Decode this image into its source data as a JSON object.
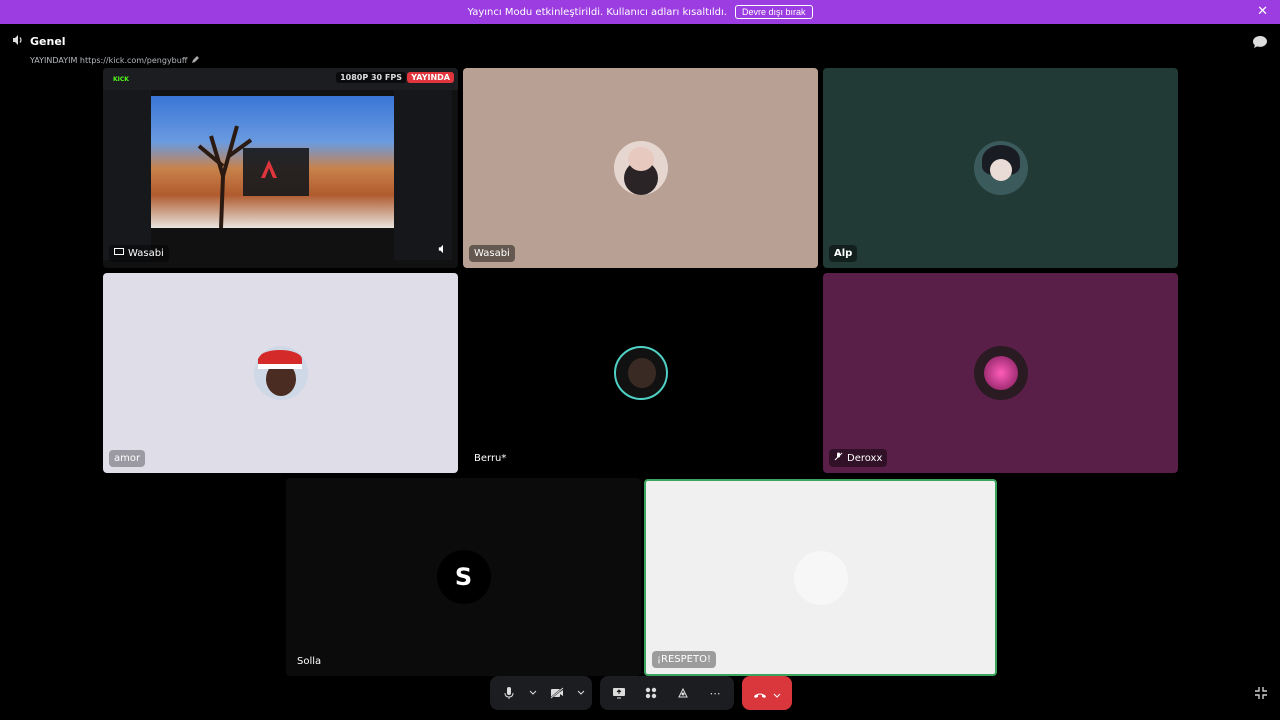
{
  "banner": {
    "message": "Yayıncı Modu etkinleştirildi. Kullanıcı adları kısaltıldı.",
    "disable_label": "Devre dışı bırak",
    "close_symbol": "✕"
  },
  "header": {
    "channel_name": "Genel",
    "status_text": "YAYINDAYIM https://kick.com/pengybuff"
  },
  "stream_tile": {
    "quality_badge": "1080P 30 FPS",
    "live_badge": "YAYINDA",
    "user": "Wasabi",
    "site_logo": "KICK"
  },
  "participants": [
    {
      "name": "Wasabi",
      "bg": "#b8a094"
    },
    {
      "name": "Alp",
      "bg": "#223a36"
    },
    {
      "name": "amor",
      "bg": "#dedde8"
    },
    {
      "name": "Berru*",
      "bg": "#000000"
    },
    {
      "name": "Deroxx",
      "bg": "#5a1f48",
      "muted": true
    },
    {
      "name": "Solla",
      "bg": "#0b0b0c",
      "initial": "S"
    },
    {
      "name": "¡RESPETO!",
      "bg": "#f0f0f0",
      "speaking": true
    }
  ],
  "controls": {
    "mic_icon": "mic-icon",
    "camera_icon": "camera-off-icon",
    "screenshare_icon": "screen-share-icon",
    "activities_icon": "activities-icon",
    "soundboard_icon": "soundboard-icon",
    "more_symbol": "⋯",
    "end_call_icon": "end-call-icon"
  },
  "colors": {
    "accent": "#9b3de0",
    "speaking_border": "#3ba55d",
    "danger": "#da373c"
  }
}
